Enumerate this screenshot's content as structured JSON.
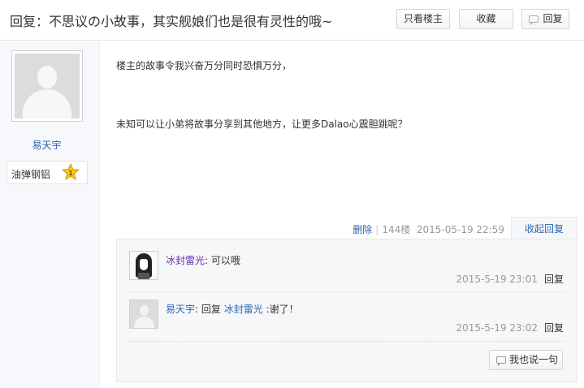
{
  "header": {
    "title": "回复：不思议の小故事，其实舰娘们也是很有灵性的哦~",
    "only_author_label": "只看楼主",
    "favorite_label": "收藏",
    "reply_label": "回复"
  },
  "author": {
    "name": "易天宇",
    "level_name": "油弹钢铝",
    "level_number": "1"
  },
  "post": {
    "lines": [
      "楼主的故事令我兴奋万分同时恐惧万分，",
      "未知可以让小弟将故事分享到其他地方，让更多Dalao心震胆跳呢？"
    ],
    "delete_label": "删除",
    "separator": "|",
    "floor": "144楼",
    "datetime": "2015-05-19 22:59",
    "collapse_label": "收起回复"
  },
  "comments": [
    {
      "user": "冰封雷光",
      "colon": ":",
      "text": "可以哦",
      "time": "2015-5-19 23:01",
      "reply_label": "回复"
    },
    {
      "user": "易天宇",
      "colon": ":",
      "reply_word": "回复",
      "reply_to": "冰封雷光",
      "text": ":谢了！",
      "time": "2015-5-19 23:02",
      "reply_label": "回复"
    }
  ],
  "say_button_label": "我也说一句",
  "colors": {
    "link_blue": "#2d64b3",
    "username_purple": "#6a2fa8",
    "star_gold": "#f5c518",
    "muted_gray": "#999999"
  }
}
